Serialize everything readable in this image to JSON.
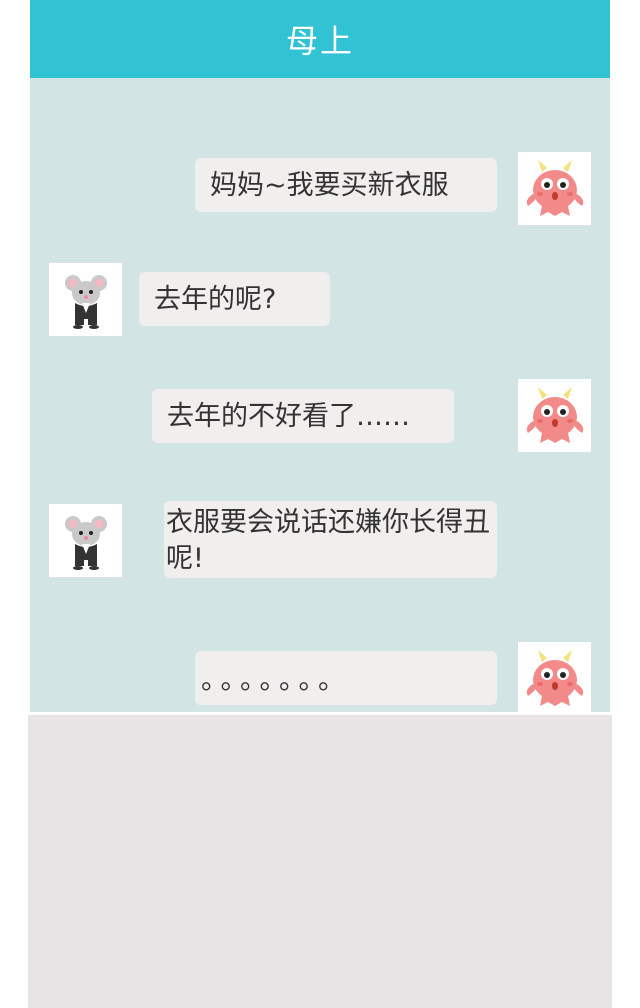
{
  "header": {
    "title": "母上"
  },
  "messages": [
    {
      "side": "right",
      "sender": "monster",
      "text": "妈妈~我要买新衣服"
    },
    {
      "side": "left",
      "sender": "mouse",
      "text": "去年的呢?"
    },
    {
      "side": "right",
      "sender": "monster",
      "text": "去年的不好看了……"
    },
    {
      "side": "left",
      "sender": "mouse",
      "text": "衣服要会说话还嫌你长得丑呢!"
    },
    {
      "side": "right",
      "sender": "monster",
      "text": "。。。。。。。"
    }
  ],
  "colors": {
    "header_bg": "#31c3d3",
    "chat_bg": "#d2e5e4",
    "bubble_bg": "#f0efee",
    "input_area_bg": "#e8e4e5",
    "monster_pink": "#f08b8b"
  },
  "icons": {
    "monster_avatar": "pink-monster-avatar-icon",
    "mouse_avatar": "grey-mouse-avatar-icon"
  }
}
